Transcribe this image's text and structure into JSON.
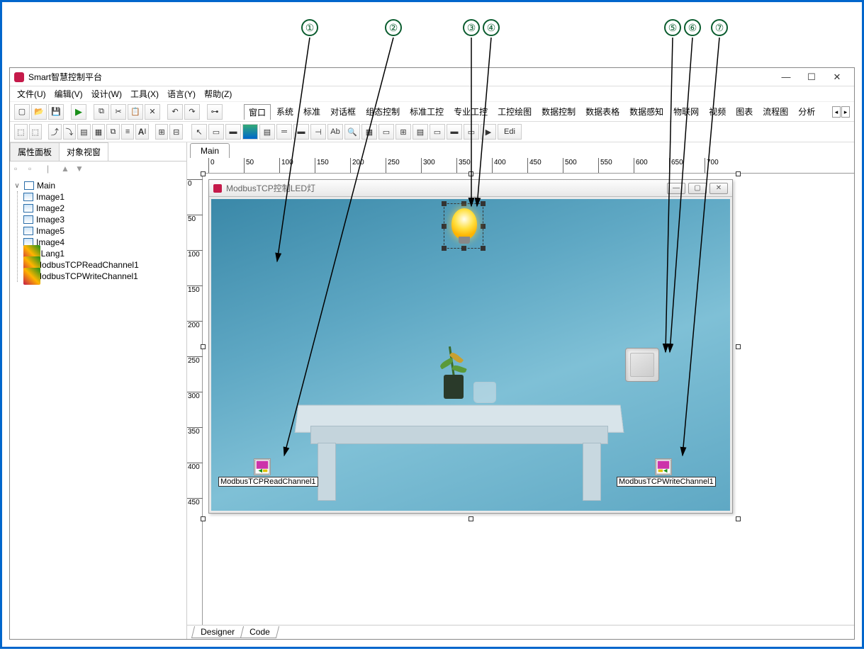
{
  "callouts": [
    "①",
    "②",
    "③",
    "④",
    "⑤",
    "⑥",
    "⑦"
  ],
  "app_title": "Smart智慧控制平台",
  "menu": [
    "文件(U)",
    "编辑(V)",
    "设计(W)",
    "工具(X)",
    "语言(Y)",
    "帮助(Z)"
  ],
  "component_tabs": [
    "窗口",
    "系统",
    "标准",
    "对话框",
    "组态控制",
    "标准工控",
    "专业工控",
    "工控绘图",
    "数据控制",
    "数据表格",
    "数据感知",
    "物联网",
    "视频",
    "图表",
    "流程图",
    "分析"
  ],
  "edit_btn": "Edi",
  "left_tabs": {
    "prop": "属性面板",
    "obj": "对象视窗"
  },
  "tree": {
    "root": "Main",
    "images": [
      "Image1",
      "Image2",
      "Image3",
      "Image5",
      "Image4"
    ],
    "others": [
      "siLang1",
      "ModbusTCPReadChannel1",
      "ModbusTCPWriteChannel1"
    ]
  },
  "main_tab": "Main",
  "inner_title": "ModbusTCP控制LED灯",
  "canvas_components": {
    "read": "ModbusTCPReadChannel1",
    "write": "ModbusTCPWriteChannel1"
  },
  "bottom_tabs": [
    "Designer",
    "Code"
  ],
  "ruler_h": [
    "0",
    "50",
    "100",
    "150",
    "200",
    "250",
    "300",
    "350",
    "400",
    "450",
    "500",
    "550",
    "600",
    "650",
    "700"
  ],
  "ruler_v": [
    "0",
    "50",
    "100",
    "150",
    "200",
    "250",
    "300",
    "350",
    "400",
    "450"
  ]
}
